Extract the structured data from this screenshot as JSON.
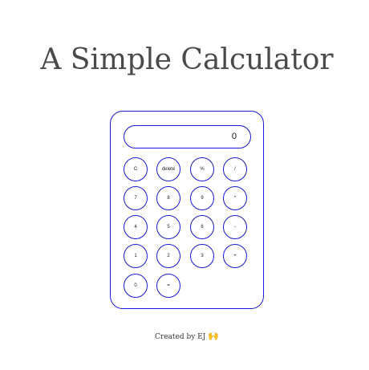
{
  "title": "A Simple Calculator",
  "display": {
    "value": "0"
  },
  "keys": {
    "clear": "C",
    "delete": "delete",
    "percent": "%",
    "divide": "/",
    "seven": "7",
    "eight": "8",
    "nine": "9",
    "multiply": "*",
    "four": "4",
    "five": "5",
    "six": "6",
    "subtract": "-",
    "one": "1",
    "two": "2",
    "three": "3",
    "add": "+",
    "zero": "0",
    "equals": "="
  },
  "footer": {
    "text": "Created by EJ",
    "emoji": "🙌"
  },
  "colors": {
    "accent_border": "#1a1ad6",
    "title_text": "#4a4a4a",
    "background": "#ffffff"
  },
  "icons": {
    "footer_emoji": "raising-hands-icon"
  }
}
